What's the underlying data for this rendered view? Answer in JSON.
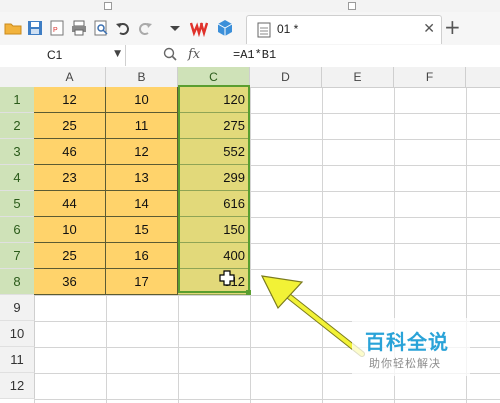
{
  "document_tab": {
    "title": "01 *"
  },
  "formula_bar": {
    "name_box": "C1",
    "fx_label": "fx",
    "formula": "=A1*B1"
  },
  "columns": [
    "A",
    "B",
    "C",
    "D",
    "E",
    "F"
  ],
  "rows": [
    "1",
    "2",
    "3",
    "4",
    "5",
    "6",
    "7",
    "8",
    "9",
    "10",
    "11",
    "12"
  ],
  "grid": {
    "r1": {
      "a": "12",
      "b": "10",
      "c": "120"
    },
    "r2": {
      "a": "25",
      "b": "11",
      "c": "275"
    },
    "r3": {
      "a": "46",
      "b": "12",
      "c": "552"
    },
    "r4": {
      "a": "23",
      "b": "13",
      "c": "299"
    },
    "r5": {
      "a": "44",
      "b": "14",
      "c": "616"
    },
    "r6": {
      "a": "10",
      "b": "15",
      "c": "150"
    },
    "r7": {
      "a": "25",
      "b": "16",
      "c": "400"
    },
    "r8": {
      "a": "36",
      "b": "17",
      "c": "612"
    }
  },
  "watermark": {
    "main": "百科全说",
    "sub": "助你轻松解决"
  },
  "colors": {
    "data_fill": "#ffd36b",
    "result_fill": "#e2d97a",
    "selection_border": "#5a9e2f",
    "arrow": "#f2f236"
  }
}
